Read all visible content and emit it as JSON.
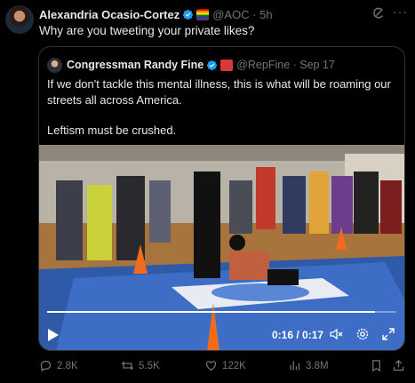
{
  "tweet": {
    "author_name": "Alexandria Ocasio-Cortez",
    "handle_time": "@AOC · 5h",
    "text": "Why are you tweeting your private likes?"
  },
  "quote": {
    "author_name": "Congressman Randy Fine",
    "handle_time": "@RepFine · Sep 17",
    "text_line1": "If we don't tackle this mental illness, this is what will be roaming our streets all across America.",
    "text_line2": "Leftism must be crushed.",
    "video": {
      "time": "0:16 / 0:17",
      "progress_fraction": 0.94
    }
  },
  "actions": {
    "replies": "2.8K",
    "reposts": "5.5K",
    "likes": "122K",
    "views": "3.8M"
  },
  "colors": {
    "background": "#000000",
    "text": "#e7e9ea",
    "muted": "#71767b",
    "verified": "#1d9bf0",
    "border": "#2f3336"
  },
  "icons": [
    "verified-badge-icon",
    "grok-icon",
    "more-icon",
    "play-icon",
    "mute-icon",
    "settings-icon",
    "fullscreen-icon",
    "reply-icon",
    "repost-icon",
    "like-icon",
    "views-icon",
    "bookmark-icon",
    "share-icon"
  ]
}
